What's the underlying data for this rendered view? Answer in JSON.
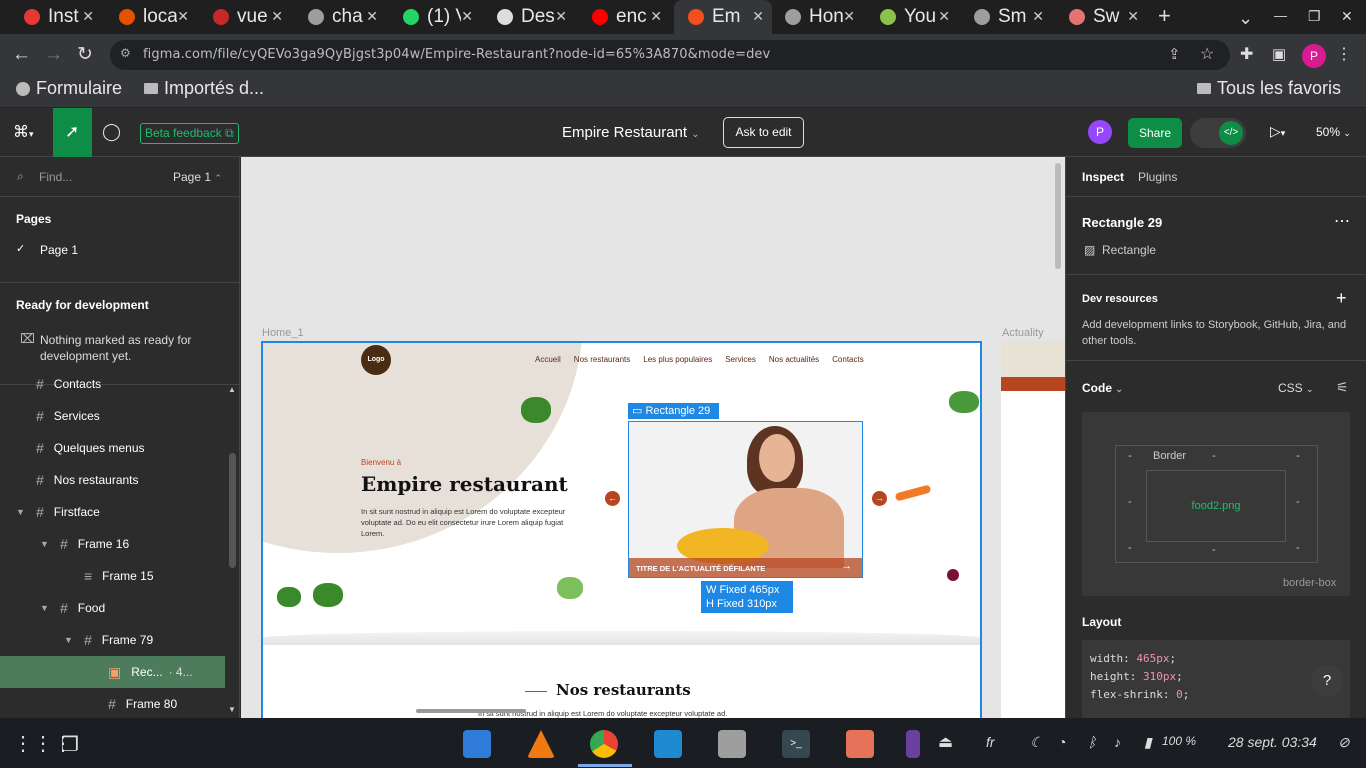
{
  "browser": {
    "tabs": [
      {
        "label": "Inst",
        "color": "#e53935"
      },
      {
        "label": "loca",
        "color": "#e65100"
      },
      {
        "label": "vue",
        "color": "#c62828"
      },
      {
        "label": "cha",
        "color": "#9e9e9e"
      },
      {
        "label": "(1) V",
        "color": "#25d366"
      },
      {
        "label": "Des",
        "color": "#ddd"
      },
      {
        "label": "enc",
        "color": "#ff0000"
      },
      {
        "label": "Em",
        "color": "#f24e1e"
      },
      {
        "label": "Hon",
        "color": "#9e9e9e"
      },
      {
        "label": "You",
        "color": "#8bc34a"
      },
      {
        "label": "Sm",
        "color": "#9e9e9e"
      },
      {
        "label": "Sw",
        "color": "#e57373"
      }
    ],
    "new_tab": "+",
    "url": "figma.com/file/cyQEVo3ga9QyBjgst3p04w/Empire-Restaurant?node-id=65%3A870&mode=dev",
    "bookmarks": [
      "Formulaire",
      "Importés d...",
      "Tous les favoris"
    ]
  },
  "figma": {
    "beta": "Beta feedback",
    "title": "Empire Restaurant",
    "ask_edit": "Ask to edit",
    "share": "Share",
    "avatar": "P",
    "zoom": "50%"
  },
  "left": {
    "search_placeholder": "Find...",
    "page_selector": "Page 1",
    "pages_title": "Pages",
    "page": "Page 1",
    "ready_title": "Ready for development",
    "ready_msg": "Nothing marked as ready for development yet.",
    "layers": [
      {
        "label": "Contacts",
        "indent": 0
      },
      {
        "label": "Services",
        "indent": 0
      },
      {
        "label": "Quelques menus",
        "indent": 0
      },
      {
        "label": "Nos restaurants",
        "indent": 0
      },
      {
        "label": "Firstface",
        "indent": 0,
        "open": true
      },
      {
        "label": "Frame 16",
        "indent": 1,
        "open": true
      },
      {
        "label": "Frame 15",
        "indent": 2
      },
      {
        "label": "Food",
        "indent": 1,
        "open": true
      },
      {
        "label": "Frame 79",
        "indent": 2,
        "open": true
      },
      {
        "label": "Rec...",
        "suffix": "· 4...",
        "indent": 3,
        "selected": true
      },
      {
        "label": "Frame 80",
        "indent": 3
      }
    ]
  },
  "canvas": {
    "frame_label": "Home_1",
    "frame2_label": "Actuality",
    "logo": "Logo",
    "nav": [
      "Accueil",
      "Nos restaurants",
      "Les plus populaires",
      "Services",
      "Nos actualités",
      "Contacts"
    ],
    "welcome": "Bienvenu à",
    "heading": "Empire restaurant",
    "body": "In sit sunt nostrud in aliquip est Lorem do voluptate excepteur voluptate ad. Do eu elit consectetur irure Lorem aliquip fugiat Lorem.",
    "selection_label": "Rectangle 29",
    "banner": "TITRE DE L'ACTUALITÉ DÉFILANTE",
    "dim_w": "W  Fixed  465px",
    "dim_h": "H  Fixed  310px",
    "section_title": "Nos restaurants",
    "section_body": "In sit sunt nostrud in aliquip est Lorem do voluptate excepteur voluptate ad."
  },
  "right": {
    "tab_inspect": "Inspect",
    "tab_plugins": "Plugins",
    "layer_name": "Rectangle 29",
    "layer_type": "Rectangle",
    "dev_title": "Dev resources",
    "dev_msg": "Add development links to Storybook, GitHub, Jira, and other tools.",
    "code_title": "Code",
    "code_lang": "CSS",
    "box_border": "Border",
    "box_fill": "food2.png",
    "box_dash": "-",
    "box_sizing": "border-box",
    "layout_title": "Layout",
    "css": [
      {
        "prop": "width",
        "val": "465px"
      },
      {
        "prop": "height",
        "val": "310px"
      },
      {
        "prop": "flex-shrink",
        "val": "0"
      }
    ],
    "help": "?"
  },
  "taskbar": {
    "lang": "fr",
    "battery": "100 %",
    "datetime": "28 sept. 03:34"
  },
  "colors": {
    "figma_green": "#0d8d45",
    "selection_blue": "#1e88e5",
    "accent_orange": "#b5461f"
  }
}
